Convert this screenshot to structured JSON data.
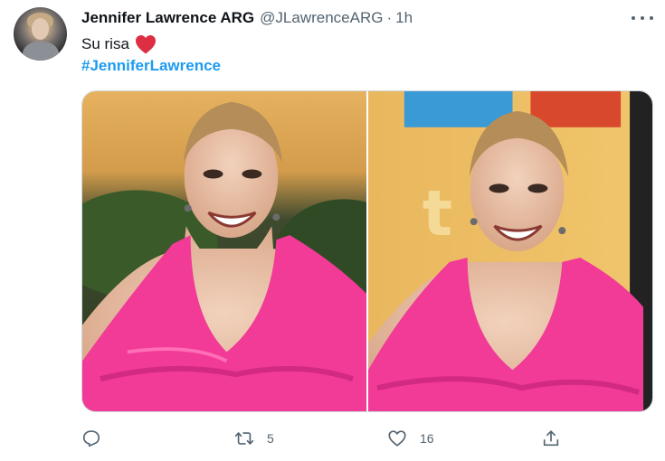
{
  "tweet": {
    "author_name": "Jennifer Lawrence ARG",
    "handle": "@JLawrenceARG",
    "separator": "·",
    "time": "1h",
    "text": "Su risa",
    "hashtag": "#JenniferLawrence"
  },
  "actions": {
    "retweet_count": "5",
    "like_count": "16"
  },
  "colors": {
    "accent": "#1d9bf0",
    "muted": "#536471",
    "heart": "#e0245e",
    "dress": "#f0389b"
  },
  "icons": [
    "more-icon",
    "heart-emoji",
    "reply-icon",
    "retweet-icon",
    "like-icon",
    "share-icon"
  ]
}
